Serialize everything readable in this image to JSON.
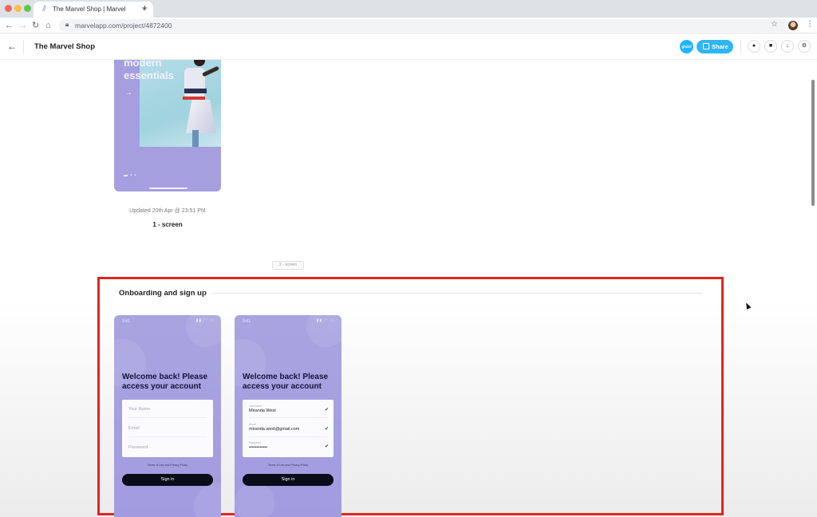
{
  "browser": {
    "tab_title": "The Marvel Shop | Marvel",
    "tab_close": "×",
    "new_tab": "+",
    "url": "marvelapp.com/project/4872400",
    "icons": [
      "back-icon",
      "forward-icon",
      "reload-icon",
      "home-icon",
      "lock-icon",
      "star-icon",
      "profile-avatar",
      "more-icon"
    ]
  },
  "app_header": {
    "project_title": "The Marvel Shop",
    "team_badge": "ghdsf",
    "share_label": "Share",
    "accent": "#2fb5f3",
    "tools": [
      "comment-icon",
      "video-icon",
      "download-icon",
      "settings-icon"
    ]
  },
  "screens": {
    "first": {
      "hero_text": "modern essentials",
      "updated": "Updated 20th Apr @ 23:51 PM",
      "count": "1 - screen"
    },
    "section_pill": "2 - screen"
  },
  "section": {
    "title": "Onboarding and sign up",
    "highlight_color": "#e3251b",
    "phone_left": {
      "time": "9:41",
      "heading": "Welcome back! Please access your account",
      "fields": [
        "Your Name",
        "Email",
        "Password"
      ],
      "legal": "Terms of Use and Privacy Policy",
      "button": "Sign in"
    },
    "phone_right": {
      "time": "9:41",
      "heading": "Welcome back! Please access your account",
      "fields": [
        {
          "label": "Username",
          "value": "Miranda West"
        },
        {
          "label": "Email",
          "value": "miranda.west@gmail.com"
        },
        {
          "label": "Password",
          "value": "••••••••••••"
        }
      ],
      "legal": "Terms of Use and Privacy Policy",
      "button": "Sign in"
    }
  }
}
